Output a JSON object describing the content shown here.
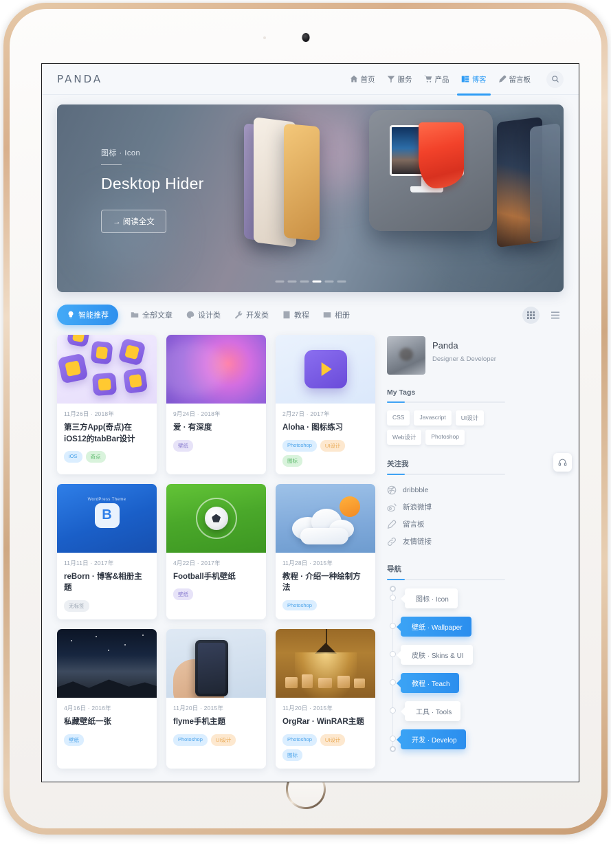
{
  "header": {
    "brand": "PANDA",
    "nav": [
      {
        "label": "首页",
        "icon": "home-icon",
        "active": false
      },
      {
        "label": "服务",
        "icon": "funnel-icon",
        "active": false
      },
      {
        "label": "产品",
        "icon": "cart-icon",
        "active": false
      },
      {
        "label": "博客",
        "icon": "blog-icon",
        "active": true
      },
      {
        "label": "留言板",
        "icon": "pen-icon",
        "active": false
      }
    ],
    "search_icon": "search-icon"
  },
  "hero": {
    "category": "图标 · Icon",
    "title": "Desktop Hider",
    "button": "→ 阅读全文",
    "dots_total": 6,
    "dot_active_index": 3
  },
  "toolbar": {
    "chips": [
      {
        "label": "智能推荐",
        "icon": "lightbulb-icon",
        "active": true
      },
      {
        "label": "全部文章",
        "icon": "folder-icon",
        "active": false
      },
      {
        "label": "设计类",
        "icon": "palette-icon",
        "active": false
      },
      {
        "label": "开发类",
        "icon": "wrench-icon",
        "active": false
      },
      {
        "label": "教程",
        "icon": "book-icon",
        "active": false
      },
      {
        "label": "相册",
        "icon": "album-icon",
        "active": false
      }
    ],
    "view_grid_icon": "grid-view-icon",
    "view_list_icon": "list-view-icon",
    "mode_switch": {
      "active_icon": "user-icon",
      "alt_icon": "flame-icon"
    }
  },
  "cards": [
    {
      "date": "11月26日 · 2018年",
      "title": "第三方App(奇点)在iOS12的tabBar设计",
      "art": "art-icons",
      "tags": [
        {
          "label": "iOS",
          "color": "blue"
        },
        {
          "label": "奇点",
          "color": "green"
        }
      ]
    },
    {
      "date": "9月24日 · 2018年",
      "title": "爱 · 有深度",
      "art": "art-love",
      "tags": [
        {
          "label": "壁纸",
          "color": "purple"
        }
      ]
    },
    {
      "date": "2月27日 · 2017年",
      "title": "Aloha · 图标练习",
      "art": "art-play",
      "tags": [
        {
          "label": "Photoshop",
          "color": "blue"
        },
        {
          "label": "UI设计",
          "color": "orange"
        },
        {
          "label": "图标",
          "color": "green"
        }
      ]
    },
    {
      "date": "11月11日 · 2017年",
      "title": "reBorn · 博客&相册主题",
      "art": "art-wp",
      "tags": [
        {
          "label": "无标签",
          "color": "gray"
        }
      ]
    },
    {
      "date": "4月22日 · 2017年",
      "title": "Football手机壁纸",
      "art": "art-ball",
      "tags": [
        {
          "label": "壁纸",
          "color": "purple"
        }
      ]
    },
    {
      "date": "11月28日 · 2015年",
      "title": "教程 · 介绍一种绘制方法",
      "art": "art-cloud",
      "tags": [
        {
          "label": "Photoshop",
          "color": "blue"
        }
      ]
    },
    {
      "date": "4月16日 · 2016年",
      "title": "私藏壁纸一张",
      "art": "art-night",
      "tags": [
        {
          "label": "壁纸",
          "color": "blue"
        }
      ]
    },
    {
      "date": "11月20日 · 2015年",
      "title": "flyme手机主题",
      "art": "art-phone",
      "tags": [
        {
          "label": "Photoshop",
          "color": "blue"
        },
        {
          "label": "UI设计",
          "color": "orange"
        }
      ]
    },
    {
      "date": "11月20日 · 2015年",
      "title": "OrgRar · WinRAR主题",
      "art": "art-lamp",
      "tags": [
        {
          "label": "Photoshop",
          "color": "blue"
        },
        {
          "label": "UI设计",
          "color": "orange"
        },
        {
          "label": "图标",
          "color": "blue"
        }
      ]
    }
  ],
  "sidebar": {
    "profile": {
      "name": "Panda",
      "role": "Designer & Developer",
      "avatar": "avatar"
    },
    "tags_section": {
      "title": "My Tags",
      "tags": [
        "CSS",
        "Javascript",
        "UI设计",
        "Web设计",
        "Photoshop"
      ]
    },
    "follow_section": {
      "title": "关注我",
      "items": [
        {
          "label": "dribbble",
          "icon": "dribbble-icon"
        },
        {
          "label": "新浪微博",
          "icon": "weibo-icon"
        },
        {
          "label": "留言板",
          "icon": "pen-icon"
        },
        {
          "label": "友情链接",
          "icon": "link-icon"
        }
      ]
    },
    "nav_section": {
      "title": "导航",
      "items": [
        {
          "label": "图标 · Icon",
          "style": "light"
        },
        {
          "label": "壁纸 · Wallpaper",
          "style": "blue"
        },
        {
          "label": "皮肤 · Skins & UI",
          "style": "light"
        },
        {
          "label": "教程 · Teach",
          "style": "blue"
        },
        {
          "label": "工具 · Tools",
          "style": "light"
        },
        {
          "label": "开发 · Develop",
          "style": "blue"
        }
      ]
    }
  },
  "fab": {
    "icon": "headphone-icon"
  },
  "colors": {
    "accent": "#2e9cf5",
    "accent_dark": "#2b8eee",
    "text": "#2d3440",
    "muted": "#8d97a5",
    "bg": "#f5f7fa"
  }
}
